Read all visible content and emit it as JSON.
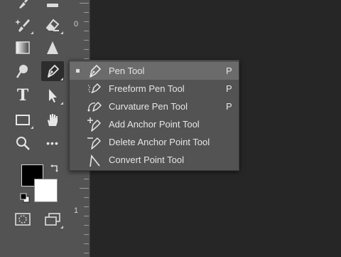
{
  "toolbar": {
    "tools": [
      {
        "name": "brush-tool",
        "icon": "brush-icon"
      },
      {
        "name": "eraser-tool",
        "icon": "eraser-icon"
      },
      {
        "name": "clone-stamp-tool",
        "icon": "sparkle-brush-icon"
      },
      {
        "name": "eraser-tool-2",
        "icon": "eraser-icon"
      },
      {
        "name": "gradient-tool",
        "icon": "gradient-icon"
      },
      {
        "name": "blur-tool",
        "icon": "triangle-icon"
      },
      {
        "name": "dodge-tool",
        "icon": "dodge-icon"
      },
      {
        "name": "pen-tool",
        "icon": "pen-icon"
      },
      {
        "name": "type-tool",
        "icon": "type-icon"
      },
      {
        "name": "path-selection-tool",
        "icon": "arrow-icon"
      },
      {
        "name": "rectangle-tool",
        "icon": "rectangle-icon"
      },
      {
        "name": "hand-tool",
        "icon": "hand-icon"
      },
      {
        "name": "zoom-tool",
        "icon": "magnifier-icon"
      },
      {
        "name": "more-tools",
        "icon": "ellipsis-icon"
      }
    ],
    "type_glyph": "T",
    "more_glyph": "•••",
    "foreground_color": "#000000",
    "background_color": "#ffffff"
  },
  "ruler": {
    "labels": [
      "0",
      "1"
    ]
  },
  "flyout": {
    "items": [
      {
        "label": "Pen Tool",
        "shortcut": "P",
        "selected": true,
        "icon": "pen-icon"
      },
      {
        "label": "Freeform Pen Tool",
        "shortcut": "P",
        "selected": false,
        "icon": "freeform-pen-icon"
      },
      {
        "label": "Curvature Pen Tool",
        "shortcut": "P",
        "selected": false,
        "icon": "curvature-pen-icon"
      },
      {
        "label": "Add Anchor Point Tool",
        "shortcut": "",
        "selected": false,
        "icon": "add-anchor-icon"
      },
      {
        "label": "Delete Anchor Point Tool",
        "shortcut": "",
        "selected": false,
        "icon": "delete-anchor-icon"
      },
      {
        "label": "Convert Point Tool",
        "shortcut": "",
        "selected": false,
        "icon": "convert-point-icon"
      }
    ]
  },
  "colors": {
    "toolbar_bg": "#535353",
    "canvas_bg": "#262626",
    "menu_bg": "#535353",
    "menu_selected_bg": "#6b6b6b",
    "text": "#e6e6e6"
  }
}
